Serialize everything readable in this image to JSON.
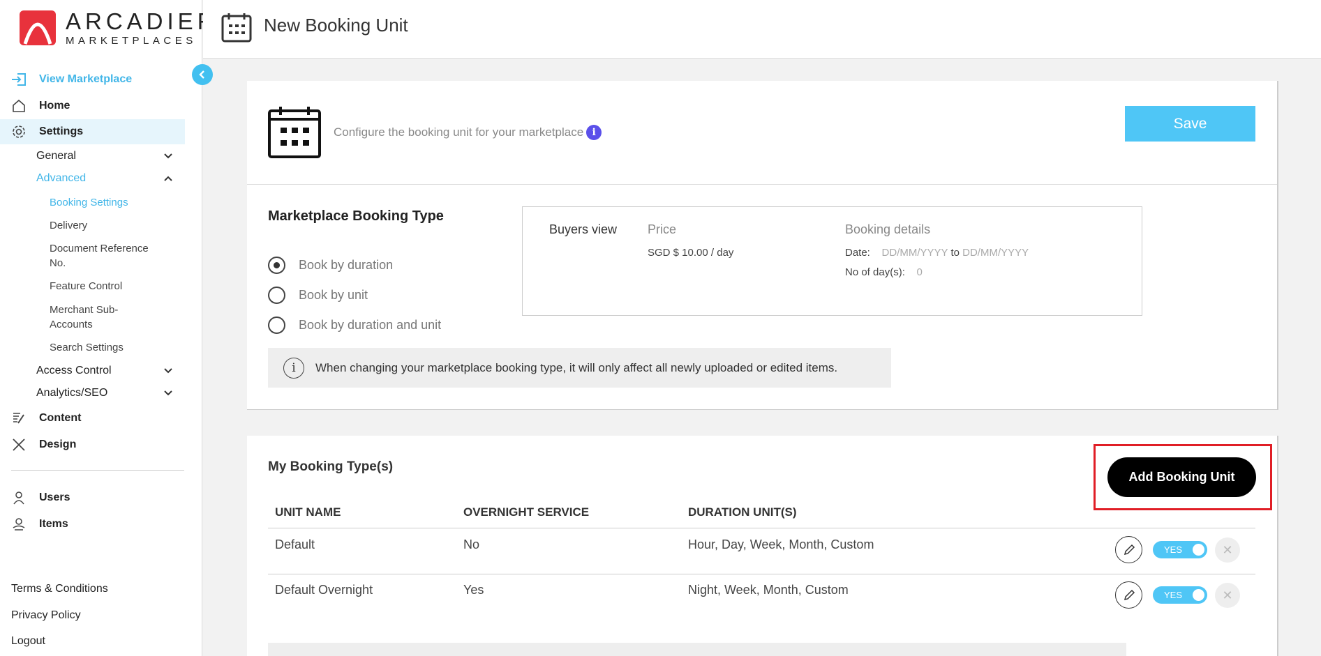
{
  "brand": {
    "name_line1": "ARCADIER",
    "name_line2": "MARKETPLACES",
    "red": "#e8323c",
    "accent": "#42b6e8"
  },
  "header": {
    "title": "New Booking Unit",
    "icon": "calendar-icon"
  },
  "sidebar": {
    "view_marketplace": "View Marketplace",
    "home": "Home",
    "settings": "Settings",
    "general": "General",
    "advanced": "Advanced",
    "advanced_items": [
      "Booking Settings",
      "Delivery",
      "Document Reference No.",
      "Feature Control",
      "Merchant Sub-Accounts",
      "Search Settings"
    ],
    "access_control": "Access Control",
    "analytics_seo": "Analytics/SEO",
    "content": "Content",
    "design": "Design",
    "users": "Users",
    "items": "Items",
    "terms": "Terms & Conditions",
    "privacy": "Privacy Policy",
    "logout": "Logout"
  },
  "config": {
    "description": "Configure the booking unit for your marketplace",
    "save_label": "Save"
  },
  "booking_type": {
    "title": "Marketplace Booking Type",
    "options": [
      "Book by duration",
      "Book by unit",
      "Book by duration and unit"
    ],
    "selected": "Book by duration",
    "buyers_view": {
      "label": "Buyers view",
      "price_heading": "Price",
      "price_value": "SGD $ 10.00 / day",
      "details_heading": "Booking details",
      "date_label": "Date:",
      "date_from": "DD/MM/YYYY",
      "date_to_word": "to",
      "date_to": "DD/MM/YYYY",
      "days_label": "No of day(s):",
      "days_value": "0"
    },
    "notice": "When changing your marketplace booking type, it will only affect all newly uploaded or edited items."
  },
  "my_types": {
    "title": "My Booking Type(s)",
    "add_label": "Add Booking Unit",
    "columns": [
      "UNIT NAME",
      "OVERNIGHT SERVICE",
      "DURATION UNIT(S)"
    ],
    "rows": [
      {
        "name": "Default",
        "overnight": "No",
        "units": "Hour, Day, Week, Month, Custom",
        "toggle": "YES"
      },
      {
        "name": "Default Overnight",
        "overnight": "Yes",
        "units": "Night, Week, Month, Custom",
        "toggle": "YES"
      }
    ]
  }
}
